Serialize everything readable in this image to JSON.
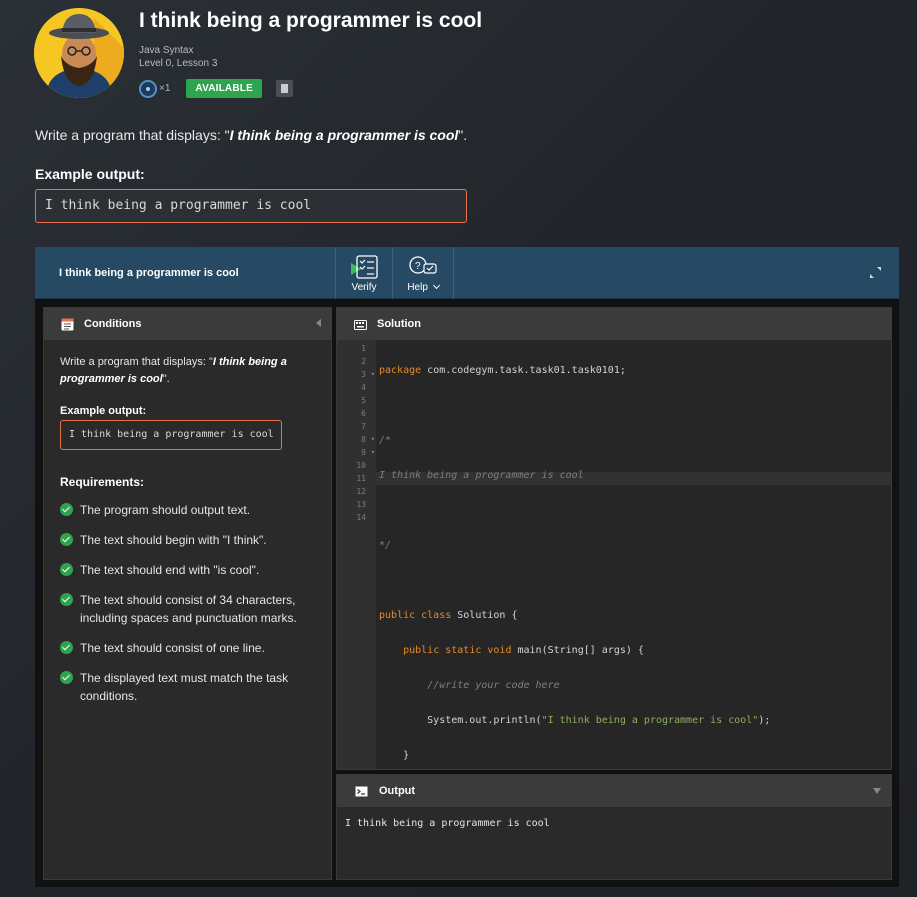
{
  "header": {
    "title": "I think being a programmer is cool",
    "course": "Java Syntax",
    "level": "Level 0, Lesson 3",
    "coin_count": "×1",
    "status": "AVAILABLE"
  },
  "task": {
    "desc_prefix": "Write a program that displays: \"",
    "desc_quote": "I think being a programmer is cool",
    "desc_suffix": "\".",
    "example_label": "Example output:",
    "example_output": "I think being a programmer is cool"
  },
  "ide": {
    "title": "I think being a programmer is cool",
    "verify_label": "Verify",
    "help_label": "Help"
  },
  "conditions": {
    "header": "Conditions",
    "desc_prefix": "Write a program that displays: \"",
    "desc_quote": "I think being a programmer is cool",
    "desc_suffix": "\".",
    "example_label": "Example output:",
    "example_output": "I think being a programmer is cool",
    "requirements_label": "Requirements:",
    "requirements": [
      "The program should output text.",
      "The text should begin with \"I think\".",
      "The text should end with \"is cool\".",
      "The text should consist of 34 characters, including spaces and punctuation marks.",
      "The text should consist of one line.",
      "The displayed text must match the task conditions."
    ]
  },
  "solution": {
    "header": "Solution",
    "line_numbers": [
      "1",
      "2",
      "3",
      "4",
      "5",
      "6",
      "7",
      "8",
      "9",
      "10",
      "11",
      "12",
      "13",
      "14"
    ],
    "code": {
      "l1_kw": "package",
      "l1_rest": " com.codegym.task.task01.task0101;",
      "l3": "/*",
      "l4": "I think being a programmer is cool",
      "l6": "*/",
      "l8_kw": "public class",
      "l8_rest": " Solution {",
      "l9_indent": "    ",
      "l9_kw": "public static void",
      "l9_rest": " main(String[] args) {",
      "l10_indent": "        ",
      "l10_cm": "//write your code here",
      "l11_pre": "        System.out.println(",
      "l11_str": "\"I think being a programmer is cool\"",
      "l11_post": ");",
      "l12": "    }",
      "l13": "}"
    }
  },
  "output": {
    "header": "Output",
    "text": "I think being a programmer is cool"
  }
}
